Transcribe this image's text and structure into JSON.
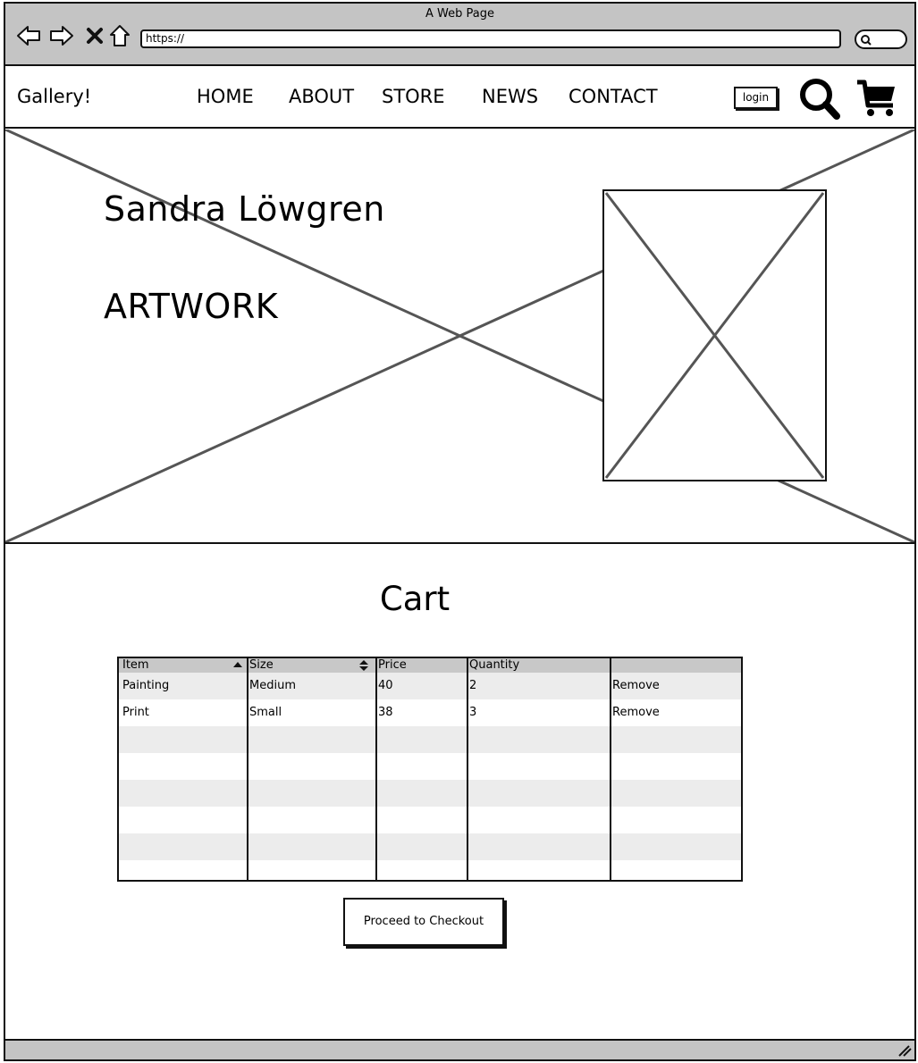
{
  "browser": {
    "title": "A Web Page",
    "url": "https://",
    "back_icon": "back-arrow-icon",
    "forward_icon": "forward-arrow-icon",
    "stop_icon": "close-icon",
    "home_icon": "home-icon",
    "search_icon": "search-icon"
  },
  "header": {
    "logo": "Gallery!",
    "nav": [
      "HOME",
      "ABOUT",
      "STORE",
      "NEWS",
      "CONTACT"
    ],
    "login_label": "login",
    "search_icon": "magnifier-icon",
    "cart_icon": "shopping-cart-icon"
  },
  "hero": {
    "name": "Sandra Löwgren",
    "subtitle": "ARTWORK"
  },
  "cart": {
    "title": "Cart",
    "columns": [
      "Item",
      "Size",
      "Price",
      "Quantity",
      ""
    ],
    "rows": [
      {
        "item": "Painting",
        "size": "Medium",
        "price": "40",
        "quantity": "2",
        "action": "Remove"
      },
      {
        "item": "Print",
        "size": "Small",
        "price": "38",
        "quantity": "3",
        "action": "Remove"
      }
    ],
    "checkout_label": "Proceed to Checkout"
  },
  "colors": {
    "chrome": "#c4c4c4",
    "header_row": "#c8c8c8",
    "alt_row": "#ececec",
    "line": "#111111"
  }
}
